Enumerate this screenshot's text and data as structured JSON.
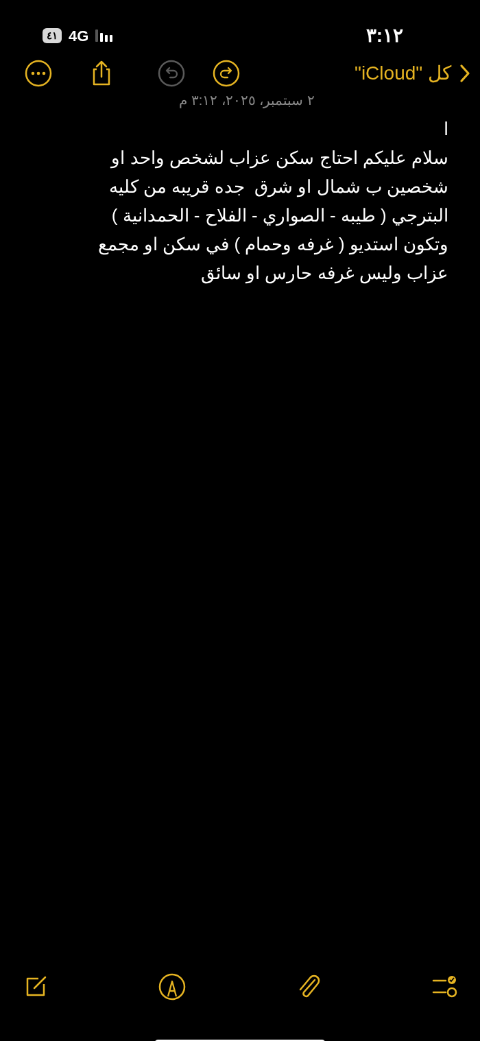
{
  "status_bar": {
    "time": "٣:١٢",
    "network": "4G",
    "battery": "٤١"
  },
  "nav": {
    "back_label": "كل \"iCloud\"",
    "actions": [
      {
        "kind": "more",
        "disabled": false
      },
      {
        "kind": "share",
        "disabled": false
      },
      {
        "kind": "undo",
        "disabled": true
      },
      {
        "kind": "redo",
        "disabled": false
      }
    ]
  },
  "note": {
    "date": "٢ سبتمبر، ٢٠٢٥، ٣:١٢ م",
    "lines": [
      "ا",
      "سلام عليكم احتاج سكن عزاب لشخص واحد او",
      "شخصين ب شمال او شرق  جده قريبه من كليه",
      "البترجي ( طيبه - الصواري - الفلاح - الحمدانية )",
      "وتكون استديو ( غرفه وحمام ) في سكن او مجمع",
      "عزاب وليس غرفه حارس او سائق"
    ]
  },
  "bottom_toolbar": [
    {
      "kind": "compose"
    },
    {
      "kind": "markup"
    },
    {
      "kind": "attach"
    },
    {
      "kind": "checklist"
    }
  ]
}
